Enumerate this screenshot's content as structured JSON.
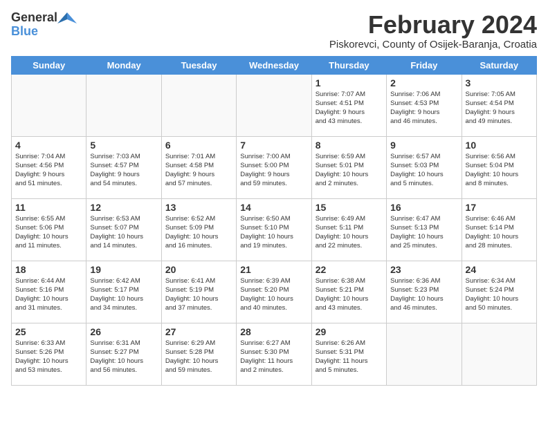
{
  "logo": {
    "general": "General",
    "blue": "Blue"
  },
  "title": "February 2024",
  "subtitle": "Piskorevci, County of Osijek-Baranja, Croatia",
  "headers": [
    "Sunday",
    "Monday",
    "Tuesday",
    "Wednesday",
    "Thursday",
    "Friday",
    "Saturday"
  ],
  "weeks": [
    [
      {
        "day": "",
        "info": ""
      },
      {
        "day": "",
        "info": ""
      },
      {
        "day": "",
        "info": ""
      },
      {
        "day": "",
        "info": ""
      },
      {
        "day": "1",
        "info": "Sunrise: 7:07 AM\nSunset: 4:51 PM\nDaylight: 9 hours\nand 43 minutes."
      },
      {
        "day": "2",
        "info": "Sunrise: 7:06 AM\nSunset: 4:53 PM\nDaylight: 9 hours\nand 46 minutes."
      },
      {
        "day": "3",
        "info": "Sunrise: 7:05 AM\nSunset: 4:54 PM\nDaylight: 9 hours\nand 49 minutes."
      }
    ],
    [
      {
        "day": "4",
        "info": "Sunrise: 7:04 AM\nSunset: 4:56 PM\nDaylight: 9 hours\nand 51 minutes."
      },
      {
        "day": "5",
        "info": "Sunrise: 7:03 AM\nSunset: 4:57 PM\nDaylight: 9 hours\nand 54 minutes."
      },
      {
        "day": "6",
        "info": "Sunrise: 7:01 AM\nSunset: 4:58 PM\nDaylight: 9 hours\nand 57 minutes."
      },
      {
        "day": "7",
        "info": "Sunrise: 7:00 AM\nSunset: 5:00 PM\nDaylight: 9 hours\nand 59 minutes."
      },
      {
        "day": "8",
        "info": "Sunrise: 6:59 AM\nSunset: 5:01 PM\nDaylight: 10 hours\nand 2 minutes."
      },
      {
        "day": "9",
        "info": "Sunrise: 6:57 AM\nSunset: 5:03 PM\nDaylight: 10 hours\nand 5 minutes."
      },
      {
        "day": "10",
        "info": "Sunrise: 6:56 AM\nSunset: 5:04 PM\nDaylight: 10 hours\nand 8 minutes."
      }
    ],
    [
      {
        "day": "11",
        "info": "Sunrise: 6:55 AM\nSunset: 5:06 PM\nDaylight: 10 hours\nand 11 minutes."
      },
      {
        "day": "12",
        "info": "Sunrise: 6:53 AM\nSunset: 5:07 PM\nDaylight: 10 hours\nand 14 minutes."
      },
      {
        "day": "13",
        "info": "Sunrise: 6:52 AM\nSunset: 5:09 PM\nDaylight: 10 hours\nand 16 minutes."
      },
      {
        "day": "14",
        "info": "Sunrise: 6:50 AM\nSunset: 5:10 PM\nDaylight: 10 hours\nand 19 minutes."
      },
      {
        "day": "15",
        "info": "Sunrise: 6:49 AM\nSunset: 5:11 PM\nDaylight: 10 hours\nand 22 minutes."
      },
      {
        "day": "16",
        "info": "Sunrise: 6:47 AM\nSunset: 5:13 PM\nDaylight: 10 hours\nand 25 minutes."
      },
      {
        "day": "17",
        "info": "Sunrise: 6:46 AM\nSunset: 5:14 PM\nDaylight: 10 hours\nand 28 minutes."
      }
    ],
    [
      {
        "day": "18",
        "info": "Sunrise: 6:44 AM\nSunset: 5:16 PM\nDaylight: 10 hours\nand 31 minutes."
      },
      {
        "day": "19",
        "info": "Sunrise: 6:42 AM\nSunset: 5:17 PM\nDaylight: 10 hours\nand 34 minutes."
      },
      {
        "day": "20",
        "info": "Sunrise: 6:41 AM\nSunset: 5:19 PM\nDaylight: 10 hours\nand 37 minutes."
      },
      {
        "day": "21",
        "info": "Sunrise: 6:39 AM\nSunset: 5:20 PM\nDaylight: 10 hours\nand 40 minutes."
      },
      {
        "day": "22",
        "info": "Sunrise: 6:38 AM\nSunset: 5:21 PM\nDaylight: 10 hours\nand 43 minutes."
      },
      {
        "day": "23",
        "info": "Sunrise: 6:36 AM\nSunset: 5:23 PM\nDaylight: 10 hours\nand 46 minutes."
      },
      {
        "day": "24",
        "info": "Sunrise: 6:34 AM\nSunset: 5:24 PM\nDaylight: 10 hours\nand 50 minutes."
      }
    ],
    [
      {
        "day": "25",
        "info": "Sunrise: 6:33 AM\nSunset: 5:26 PM\nDaylight: 10 hours\nand 53 minutes."
      },
      {
        "day": "26",
        "info": "Sunrise: 6:31 AM\nSunset: 5:27 PM\nDaylight: 10 hours\nand 56 minutes."
      },
      {
        "day": "27",
        "info": "Sunrise: 6:29 AM\nSunset: 5:28 PM\nDaylight: 10 hours\nand 59 minutes."
      },
      {
        "day": "28",
        "info": "Sunrise: 6:27 AM\nSunset: 5:30 PM\nDaylight: 11 hours\nand 2 minutes."
      },
      {
        "day": "29",
        "info": "Sunrise: 6:26 AM\nSunset: 5:31 PM\nDaylight: 11 hours\nand 5 minutes."
      },
      {
        "day": "",
        "info": ""
      },
      {
        "day": "",
        "info": ""
      }
    ]
  ]
}
